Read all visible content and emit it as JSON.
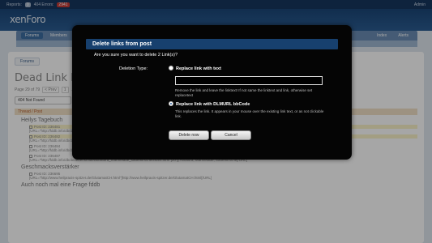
{
  "topbar": {
    "reports_label": "Reports:",
    "reports_count": "0",
    "errors_label": "404 Errors:",
    "errors_count": "2941",
    "user": "Admin"
  },
  "logo": "xenForo",
  "nav": {
    "tabs": [
      "Forums",
      "Members",
      "Index",
      "Alerts"
    ]
  },
  "breadcrumb": "Forums",
  "page": {
    "title": "Dead Link Management | Page 29",
    "page_info": "Page 29 of 79",
    "prev": "< Prev",
    "pages": [
      "1",
      "..."
    ],
    "filter": "404 Not Found",
    "section": "Thread / Post"
  },
  "threads": [
    {
      "title": "Heilys Tagebuch",
      "posts": [
        {
          "id": "Post ID: 236481",
          "url": "[URL=\"http://fddb.info/db/de/lebensmittel/...\"]",
          "hl": true
        },
        {
          "id": "Post ID: 236482",
          "url": "[URL=\"http://fddb.info/db/de/lebensmittel/...\"]",
          "hl": true
        },
        {
          "id": "Post ID: 236484",
          "url": "[URL=\"http://fddb.info/db/de/lebensmittel/k-classic_k-classic_studentenfutter/index.html\"]50 g K-Classic, Studentenfutter[/URL]",
          "hl": false
        },
        {
          "id": "Post ID: 236487",
          "url": "[URL=\"http://fddb.info/db/de/lebensmittel/alnatura_marmelade_sauerkirsche/index.html\"]20 g Alnatura, Marmelade, Sauerkirsche[/URL]",
          "hl": false
        }
      ]
    },
    {
      "title": "Geschmacksverstärker",
      "posts": [
        {
          "id": "Post ID: 236695",
          "url": "[URL=\"http://www.heilpraxis-spitzer.de/GlutamatCH.html\"]http://www.heilpraxis-spitzer.de/GlutamatCH.html[/URL]",
          "hl": false
        }
      ]
    },
    {
      "title": "Auch noch mal eine Frage fddb",
      "posts": []
    }
  ],
  "dialog": {
    "title": "Delete links from post",
    "question": "Are you sure you want to delete 2 Link(s)?",
    "deletion_type_label": "Deletion Type:",
    "option1_label": "Replace link with text",
    "option1_hint": "Remove the link and leave the linktext! If not same the linktext and link, otherwise set replacetext",
    "option1_value": "",
    "option2_label": "Replace link with DLMURL bbCode",
    "option2_hint": "This replaces the link. It appears in your mouse over the existing link text, or as not clickable link.",
    "delete_button": "Delete now",
    "cancel_button": "Cancel",
    "selected_option": 2
  }
}
